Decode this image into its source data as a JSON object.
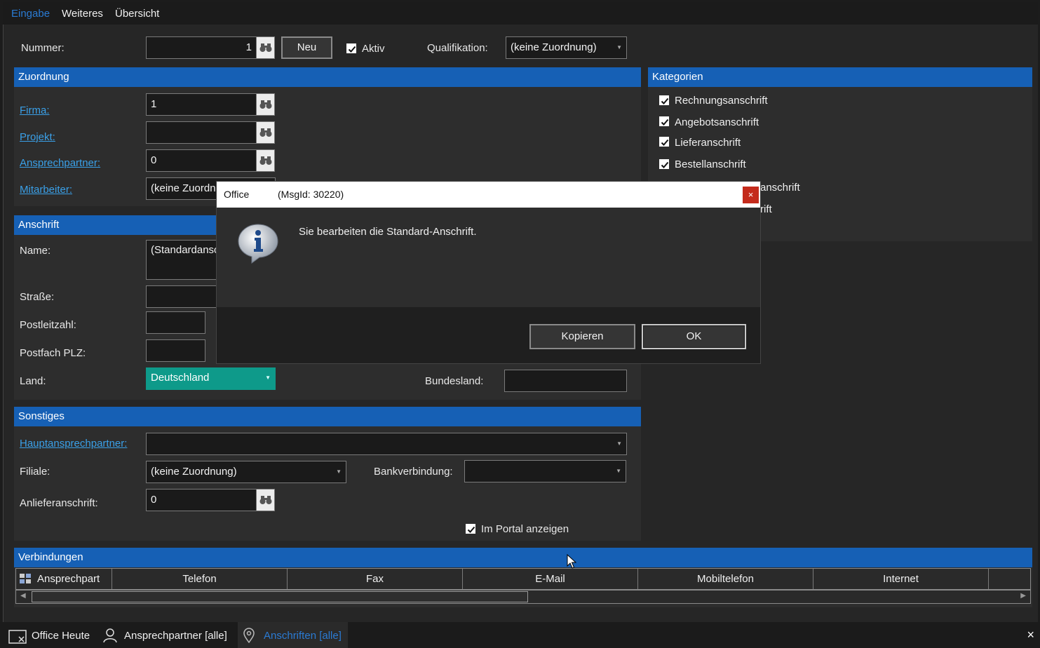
{
  "menu": {
    "tabs": [
      "Eingabe",
      "Weiteres",
      "Übersicht"
    ],
    "active_tab": "Eingabe"
  },
  "top": {
    "nummer_label": "Nummer:",
    "nummer_value": "1",
    "neu_button": "Neu",
    "aktiv_label": "Aktiv",
    "aktiv_checked": true,
    "qualifikation_label": "Qualifikation:",
    "qualifikation_value": "(keine Zuordnung)"
  },
  "zuordnung": {
    "header": "Zuordnung",
    "firma_label": "Firma:",
    "firma_value": "1",
    "projekt_label": "Projekt:",
    "projekt_value": "",
    "ansprechpartner_label": "Ansprechpartner:",
    "ansprechpartner_value": "0",
    "mitarbeiter_label": "Mitarbeiter:",
    "mitarbeiter_value": "(keine Zuordnung)"
  },
  "kategorien": {
    "header": "Kategorien",
    "items": [
      {
        "label": "Rechnungsanschrift",
        "checked": true
      },
      {
        "label": "Angebotsanschrift",
        "checked": true
      },
      {
        "label": "Lieferanschrift",
        "checked": true
      },
      {
        "label": "Bestellanschrift",
        "checked": true
      },
      {
        "label": "anschrift",
        "checked": false
      },
      {
        "label": "rift",
        "checked": false
      }
    ]
  },
  "anschrift": {
    "header": "Anschrift",
    "name_label": "Name:",
    "name_value": "(Standardanschrift)",
    "strasse_label": "Straße:",
    "plz_label": "Postleitzahl:",
    "postfach_label": "Postfach PLZ:",
    "land_label": "Land:",
    "land_value": "Deutschland",
    "bundesland_label": "Bundesland:",
    "bundesland_value": ""
  },
  "sonstiges": {
    "header": "Sonstiges",
    "hauptansprechpartner_label": "Hauptansprechpartner:",
    "hauptansprechpartner_value": "",
    "filiale_label": "Filiale:",
    "filiale_value": "(keine Zuordnung)",
    "bankverbindung_label": "Bankverbindung:",
    "bankverbindung_value": "",
    "anlieferanschrift_label": "Anlieferanschrift:",
    "anlieferanschrift_value": "0",
    "portal_label": "Im Portal anzeigen",
    "portal_checked": true
  },
  "verbindungen": {
    "header": "Verbindungen",
    "columns": [
      "Ansprechpart",
      "Telefon",
      "Fax",
      "E-Mail",
      "Mobiltelefon",
      "Internet"
    ]
  },
  "dialog": {
    "title": "Office",
    "msgid": "(MsgId: 30220)",
    "close": "×",
    "message": "Sie bearbeiten die Standard-Anschrift.",
    "copy_button": "Kopieren",
    "ok_button": "OK"
  },
  "statusbar": {
    "items": [
      "Office Heute",
      "Ansprechpartner [alle]",
      "Anschriften [alle]"
    ],
    "active": "Anschriften [alle]",
    "close": "×"
  },
  "colors": {
    "accent": "#1660b5",
    "link": "#3aa0e8",
    "teal": "#0e9a8a",
    "close_red": "#c42b1c"
  }
}
